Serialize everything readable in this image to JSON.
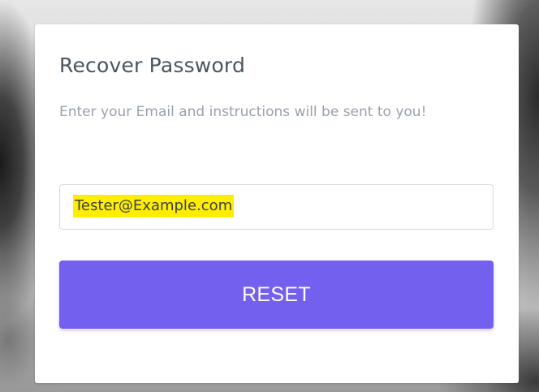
{
  "form": {
    "title": "Recover Password",
    "subtitle": "Enter your Email and instructions will be sent to you!",
    "email_value": "Tester@Example.com",
    "reset_label": "RESET"
  },
  "colors": {
    "accent": "#7460ee",
    "highlight": "#ffee00",
    "title": "#4a5560",
    "subtitle": "#98a1ab"
  }
}
